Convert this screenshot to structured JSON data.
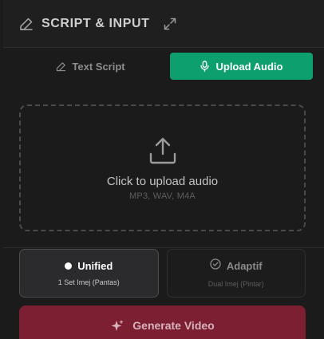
{
  "header": {
    "title": "SCRIPT & INPUT",
    "icon": "pencil-icon",
    "expand_icon": "expand-icon"
  },
  "tabs": [
    {
      "label": "Text Script",
      "icon": "pencil-icon",
      "active": false
    },
    {
      "label": "Upload Audio",
      "icon": "microphone-icon",
      "active": true
    }
  ],
  "upload": {
    "icon": "upload-icon",
    "title": "Click to upload audio",
    "formats": "MP3, WAV, M4A"
  },
  "modes": [
    {
      "label": "Unified",
      "sub": "1 Set Imej (Pantas)",
      "icon": "dot-icon",
      "selected": true
    },
    {
      "label": "Adaptif",
      "sub": "Dual Imej (Pintar)",
      "icon": "check-circle-icon",
      "selected": false
    }
  ],
  "generate": {
    "label": "Generate Video",
    "icon": "sparkle-icon"
  },
  "colors": {
    "accent": "#0e9f6e",
    "generate_bg": "#7d1f33",
    "panel_bg": "#1b1b1c"
  }
}
